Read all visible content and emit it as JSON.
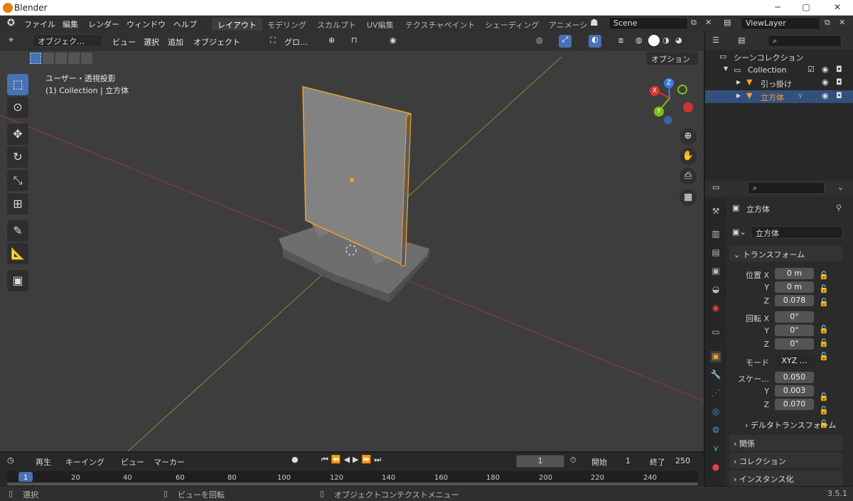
{
  "window": {
    "title": "Blender",
    "min": "─",
    "max": "▢",
    "close": "✕"
  },
  "topmenu": [
    "ファイル",
    "編集",
    "レンダー",
    "ウィンドウ",
    "ヘルプ"
  ],
  "workspaces": [
    "レイアウト",
    "モデリング",
    "スカルプト",
    "UV編集",
    "テクスチャペイント",
    "シェーディング",
    "アニメーシ"
  ],
  "scene": "Scene",
  "viewlayer": "ViewLayer",
  "viewport": {
    "mode": "オブジェク…",
    "menus": [
      "ビュー",
      "選択",
      "追加",
      "オブジェクト"
    ],
    "transform": "グロ…",
    "options": "オプション",
    "info1": "ユーザー・透視投影",
    "info2": "(1) Collection | 立方体"
  },
  "gizmo": {
    "x": "X",
    "y": "Y",
    "z": "Z"
  },
  "outliner": {
    "scene_collection": "シーンコレクション",
    "collection": "Collection",
    "items": [
      "引っ掛け",
      "立方体"
    ]
  },
  "props": {
    "object_name": "立方体",
    "data_name": "立方体",
    "transform": "トランスフォーム",
    "loc_label": "位置 X",
    "rot_label": "回転 X",
    "scale_label": "スケー…",
    "y": "Y",
    "z": "Z",
    "loc": [
      "0 m",
      "0 m",
      "0.078"
    ],
    "rot": [
      "0°",
      "0°",
      "0°"
    ],
    "mode_label": "モード",
    "mode": "XYZ …",
    "scale": [
      "0.050",
      "0.003",
      "0.070"
    ],
    "delta": "デルタトランスフォーム",
    "relations": "関係",
    "collections": "コレクション",
    "instancing": "インスタンス化"
  },
  "timeline": {
    "play": "再生",
    "keying": "キーイング",
    "view": "ビュー",
    "marker": "マーカー",
    "frame": "1",
    "start_label": "開始",
    "start": "1",
    "end_label": "終了",
    "end": "250",
    "ticks": [
      "1",
      "20",
      "40",
      "60",
      "80",
      "100",
      "120",
      "140",
      "160",
      "180",
      "200",
      "220",
      "240"
    ]
  },
  "status": {
    "select": "選択",
    "rotate": "ビューを回転",
    "context": "オブジェクトコンテクストメニュー",
    "version": "3.5.1"
  }
}
